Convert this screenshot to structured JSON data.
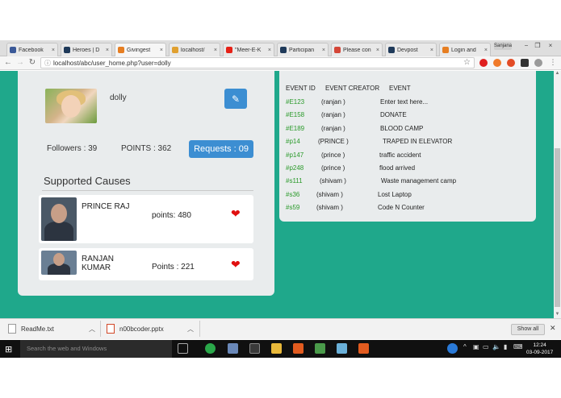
{
  "browser": {
    "tabs": [
      {
        "label": "Facebook",
        "favicon_color": "#3b5998",
        "active": false
      },
      {
        "label": "Heroes | D",
        "favicon_color": "#1f3a5a",
        "active": false
      },
      {
        "label": "Givingest",
        "favicon_color": "#e67e22",
        "active": true
      },
      {
        "label": "localhost/",
        "favicon_color": "#e0a030",
        "active": false
      },
      {
        "label": "\"Meer-E-K",
        "favicon_color": "#e62117",
        "active": false
      },
      {
        "label": "Participan",
        "favicon_color": "#1f3a5a",
        "active": false
      },
      {
        "label": "Please con",
        "favicon_color": "#d44638",
        "active": false
      },
      {
        "label": "Devpost",
        "favicon_color": "#1f3a5a",
        "active": false
      },
      {
        "label": "Login and",
        "favicon_color": "#e67e22",
        "active": false
      }
    ],
    "tab_close_glyph": "×",
    "profile_label": "Sanjana",
    "address": "localhost/abc/user_home.php?user=dolly",
    "window_controls": [
      "−",
      "❐",
      "×"
    ]
  },
  "profile": {
    "username": "dolly",
    "followers_text": "Followers : 39",
    "points_text": "POINTS : 362",
    "requests_label": "Requests : 09",
    "edit_icon": "edit-icon"
  },
  "supported_causes": {
    "title": "Supported Causes",
    "items": [
      {
        "name_line1": "PRINCE RAJ",
        "name_line2": "",
        "points_text": "points: 480"
      },
      {
        "name_line1": "RANJAN",
        "name_line2": "KUMAR",
        "points_text": "Points : 221"
      }
    ]
  },
  "events": {
    "headers": {
      "id": "EVENT ID",
      "creator": "EVENT CREATOR",
      "event": "EVENT"
    },
    "rows": [
      {
        "id": "#E123",
        "creator": "(ranjan )",
        "event": "Enter text here..."
      },
      {
        "id": "#E158",
        "creator": "(ranjan )",
        "event": "DONATE"
      },
      {
        "id": "#E189",
        "creator": "(ranjan )",
        "event": "BLOOD CAMP"
      },
      {
        "id": "#p14",
        "creator": "(PRINCE )",
        "event": "TRAPED IN ELEVATOR"
      },
      {
        "id": "#p147",
        "creator": "(prince )",
        "event": "traffic accident"
      },
      {
        "id": "#p248",
        "creator": "(prince )",
        "event": "flood arrived"
      },
      {
        "id": "#s111",
        "creator": "(shivam )",
        "event": "Waste management camp"
      },
      {
        "id": "#s36",
        "creator": "(shivam )",
        "event": "Lost Laptop"
      },
      {
        "id": "#s59",
        "creator": "(shivam )",
        "event": "Code N Counter"
      }
    ]
  },
  "downloads": {
    "items": [
      {
        "filename": "ReadMe.txt"
      },
      {
        "filename": "n00bcoder.pptx"
      }
    ],
    "show_all_label": "Show all"
  },
  "taskbar": {
    "search_placeholder": "Search the web and Windows",
    "time": "12:24",
    "date": "03-09-2017"
  },
  "colors": {
    "page_background": "#1fa88b",
    "accent_purple": "#8e3aa8",
    "button_blue": "#3c8ed2",
    "heart_red": "#e01010",
    "event_id_green": "#2a9a2a"
  }
}
